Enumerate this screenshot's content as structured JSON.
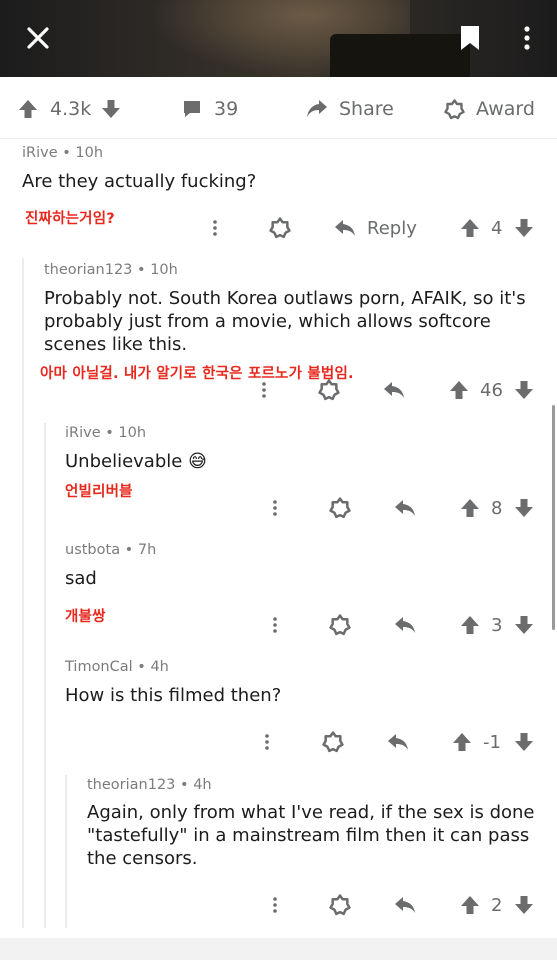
{
  "post": {
    "upvotes": "4.3k",
    "comments": "39",
    "share_label": "Share",
    "award_label": "Award"
  },
  "comments": [
    {
      "user": "iRive",
      "age": "10h",
      "text": "Are they actually fucking?",
      "kr": "진짜하는거임?",
      "reply_label": "Reply",
      "score": "4"
    },
    {
      "user": "theorian123",
      "age": "10h",
      "text": "Probably not. South Korea outlaws porn, AFAIK, so it's probably just from a movie, which allows softcore scenes like this.",
      "kr": "아마 아닐걸. 내가 알기로 한국은 포르노가 불법임.",
      "score": "46"
    },
    {
      "user": "iRive",
      "age": "10h",
      "text": "Unbelievable",
      "emoji": "😅",
      "kr": "언빌리버블",
      "score": "8"
    },
    {
      "user": "ustbota",
      "age": "7h",
      "text": "sad",
      "kr": "개불쌍",
      "score": "3"
    },
    {
      "user": "TimonCal",
      "age": "4h",
      "text": "How is this filmed then?",
      "score": "-1"
    },
    {
      "user": "theorian123",
      "age": "4h",
      "text": "Again, only from what I've read, if the sex is done \"tastefully\" in a mainstream film then it can pass the censors.",
      "score": "2"
    }
  ],
  "meta_separator": " • ",
  "colors": {
    "annotation": "#e8281c",
    "muted": "#6a6c6e",
    "thread_line": "#ececec"
  }
}
